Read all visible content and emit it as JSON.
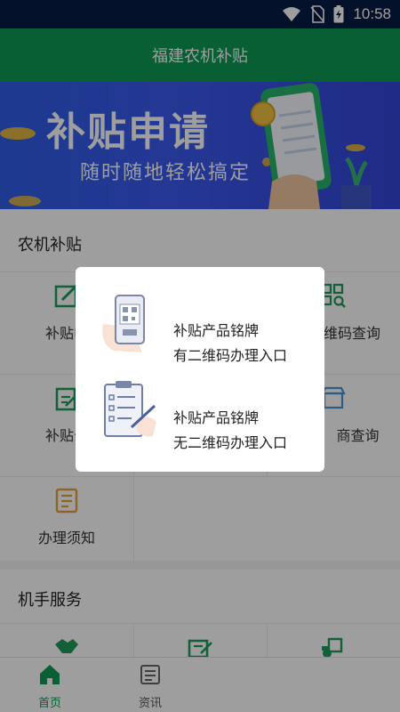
{
  "status_bar": {
    "time": "10:58"
  },
  "app_bar": {
    "title": "福建农机补贴"
  },
  "banner": {
    "title": "补贴申请",
    "subtitle": "随时随地轻松搞定"
  },
  "section_subsidy": {
    "title": "农机补贴",
    "items": [
      {
        "label": "补贴申"
      },
      {
        "label": "维码查询"
      },
      {
        "label": "补贴公"
      },
      {
        "label": "商查询"
      },
      {
        "label": "办理须知"
      }
    ]
  },
  "section_driver": {
    "title": "机手服务"
  },
  "dialog": {
    "options": [
      {
        "line1": "补贴产品铭牌",
        "line2": "有二维码办理入口"
      },
      {
        "line1": "补贴产品铭牌",
        "line2": "无二维码办理入口"
      }
    ]
  },
  "tab_bar": {
    "tabs": [
      {
        "label": "首页"
      },
      {
        "label": "资讯"
      }
    ]
  },
  "colors": {
    "primary": "#0f9a55",
    "status_bar": "#071c46",
    "banner_blue": "#3b59ee"
  }
}
